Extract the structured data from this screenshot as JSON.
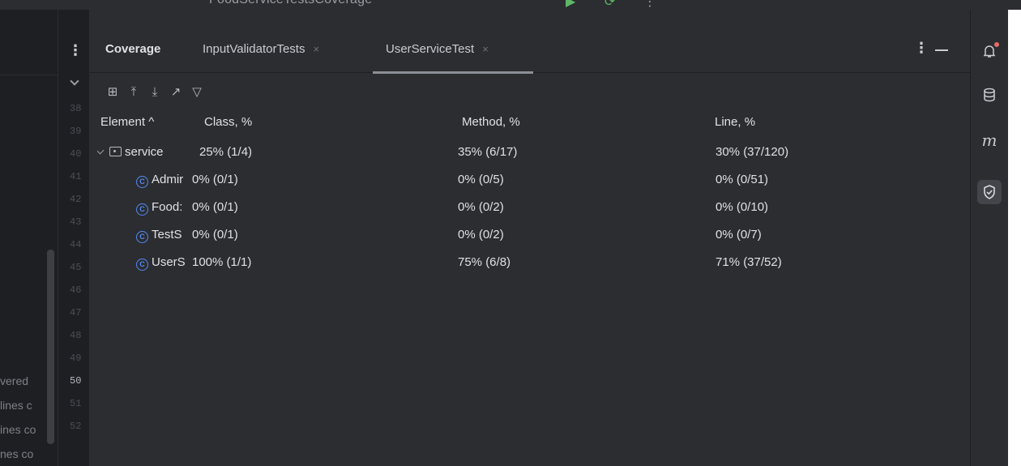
{
  "window": {
    "title_partial": "FoodServiceTestsCoverage",
    "title_glyph_1": "▶",
    "title_glyph_2": "⟳",
    "title_glyph_3": "⋮"
  },
  "editor_left": {
    "visible_fragments": [
      "vered",
      "lines c",
      "ines co",
      "nes co"
    ]
  },
  "gutter": {
    "line_numbers": [
      "38",
      "39",
      "40",
      "41",
      "42",
      "43",
      "44",
      "45",
      "46",
      "47",
      "48",
      "49",
      "50",
      "51",
      "52"
    ],
    "active_line": "50"
  },
  "tabs": [
    {
      "label": "Coverage",
      "selected": false,
      "closable": false
    },
    {
      "label": "InputValidatorTests",
      "selected": false,
      "closable": true
    },
    {
      "label": "UserServiceTest",
      "selected": true,
      "closable": true
    }
  ],
  "tab_close_glyph": "×",
  "tab_actions": {
    "more": "⋮"
  },
  "toolbar": {
    "icons": [
      "flatten-packages-icon",
      "navigate-up-icon",
      "navigate-down-icon",
      "export-icon",
      "filter-icon"
    ],
    "glyphs": [
      "⊞",
      "⤒",
      "⤓",
      "↗",
      "▽"
    ]
  },
  "table": {
    "columns": {
      "element": "Element ^",
      "class_pct": "Class, %",
      "method_pct": "Method, %",
      "line_pct": "Line, %"
    },
    "rows": [
      {
        "name": "service",
        "kind": "package",
        "class_pct": "25% (1/4)",
        "method_pct": "35% (6/17)",
        "line_pct": "30% (37/120)"
      },
      {
        "name": "Admir",
        "kind": "class",
        "class_pct": "0% (0/1)",
        "method_pct": "0% (0/5)",
        "line_pct": "0% (0/51)"
      },
      {
        "name": "Food:",
        "kind": "class",
        "class_pct": "0% (0/1)",
        "method_pct": "0% (0/2)",
        "line_pct": "0% (0/10)"
      },
      {
        "name": "TestS",
        "kind": "class",
        "class_pct": "0% (0/1)",
        "method_pct": "0% (0/2)",
        "line_pct": "0% (0/7)"
      },
      {
        "name": "UserS",
        "kind": "class",
        "class_pct": "100% (1/1)",
        "method_pct": "75% (6/8)",
        "line_pct": "71% (37/52)"
      }
    ],
    "class_icon_glyph": "C"
  },
  "right_bar": {
    "items": [
      "notifications-icon",
      "database-icon",
      "maven-icon",
      "coverage-icon"
    ],
    "glyphs": [
      "🔔",
      "☰",
      "m",
      "⛉"
    ],
    "active_item": "coverage-icon"
  }
}
